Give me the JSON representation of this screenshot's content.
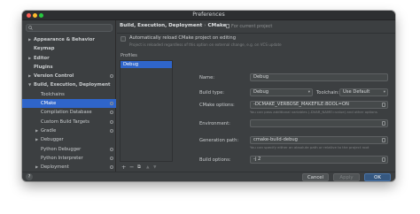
{
  "window": {
    "title": "Preferences"
  },
  "sidebar": {
    "search_placeholder": "",
    "items": [
      {
        "label": "Appearance & Behavior",
        "arrow": "▶",
        "bold": true,
        "indent": 0,
        "selected": false,
        "gear": false
      },
      {
        "label": "Keymap",
        "arrow": "",
        "bold": true,
        "indent": 0,
        "selected": false,
        "gear": false
      },
      {
        "label": "Editor",
        "arrow": "▶",
        "bold": true,
        "indent": 0,
        "selected": false,
        "gear": false
      },
      {
        "label": "Plugins",
        "arrow": "",
        "bold": true,
        "indent": 0,
        "selected": false,
        "gear": false
      },
      {
        "label": "Version Control",
        "arrow": "▶",
        "bold": true,
        "indent": 0,
        "selected": false,
        "gear": true
      },
      {
        "label": "Build, Execution, Deployment",
        "arrow": "▼",
        "bold": true,
        "indent": 0,
        "selected": false,
        "gear": false
      },
      {
        "label": "Toolchains",
        "arrow": "",
        "bold": false,
        "indent": 1,
        "selected": false,
        "gear": false
      },
      {
        "label": "CMake",
        "arrow": "",
        "bold": false,
        "indent": 1,
        "selected": true,
        "gear": true
      },
      {
        "label": "Compilation Database",
        "arrow": "",
        "bold": false,
        "indent": 1,
        "selected": false,
        "gear": true
      },
      {
        "label": "Custom Build Targets",
        "arrow": "",
        "bold": false,
        "indent": 1,
        "selected": false,
        "gear": true
      },
      {
        "label": "Gradle",
        "arrow": "▶",
        "bold": false,
        "indent": 1,
        "selected": false,
        "gear": true
      },
      {
        "label": "Debugger",
        "arrow": "▶",
        "bold": false,
        "indent": 1,
        "selected": false,
        "gear": false
      },
      {
        "label": "Python Debugger",
        "arrow": "",
        "bold": false,
        "indent": 1,
        "selected": false,
        "gear": true
      },
      {
        "label": "Python Interpreter",
        "arrow": "",
        "bold": false,
        "indent": 1,
        "selected": false,
        "gear": true
      },
      {
        "label": "Deployment",
        "arrow": "▶",
        "bold": false,
        "indent": 1,
        "selected": false,
        "gear": true
      }
    ]
  },
  "content": {
    "breadcrumb": [
      "Build, Execution, Deployment",
      "CMake"
    ],
    "breadcrumb_sep": "›",
    "scope": "For current project",
    "auto_reload": {
      "label": "Automatically reload CMake project on editing",
      "hint": "Project is reloaded regardless of this option on external change, e.g. on VCS update",
      "checked": false
    },
    "profiles_label": "Profiles",
    "profiles": [
      "Debug"
    ],
    "toolbar": {
      "add": "+",
      "remove": "−",
      "copy": "⧉",
      "up": "▲",
      "down": "▼"
    },
    "form": {
      "name_label": "Name:",
      "name_value": "Debug",
      "build_type_label": "Build type:",
      "build_type_value": "Debug",
      "toolchain_label": "Toolchain:",
      "toolchain_value": "Use Default",
      "cmake_options_label": "CMake options:",
      "cmake_options_value": "-DCMAKE_VERBOSE_MAKEFILE:BOOL=ON",
      "cmake_options_hint": "You can pass additional variables (-DVAR_NAME=value) and other options",
      "environment_label": "Environment:",
      "environment_value": "",
      "generation_path_label": "Generation path:",
      "generation_path_value": "cmake-build-debug",
      "generation_path_hint": "You can specify either an absolute path or relative to the project root",
      "build_options_label": "Build options:",
      "build_options_value": "-j 2"
    }
  },
  "footer": {
    "help": "?",
    "cancel": "Cancel",
    "apply": "Apply",
    "ok": "OK"
  },
  "colors": {
    "accent": "#2f65ca",
    "background": "#3c3f41",
    "ok_button": "#365880"
  }
}
